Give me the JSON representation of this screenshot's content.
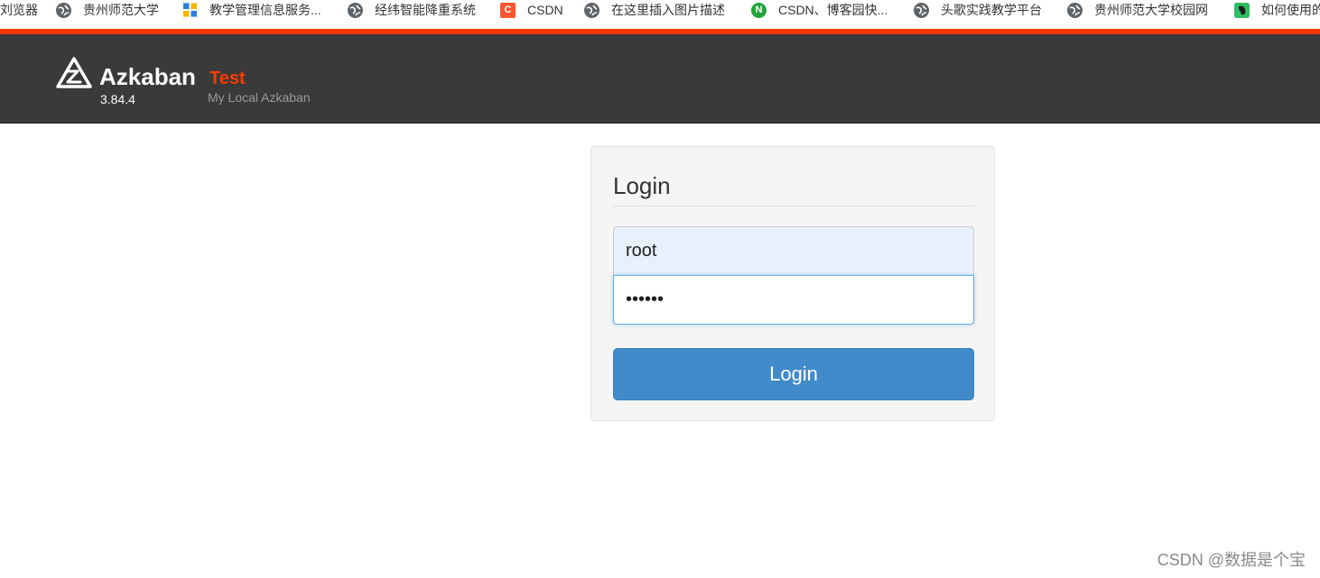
{
  "bookmarks": [
    {
      "label": "刘览器",
      "icon": "none"
    },
    {
      "label": "贵州师范大学",
      "icon": "globe-icon"
    },
    {
      "label": "教学管理信息服务...",
      "icon": "cube-icon"
    },
    {
      "label": "经纬智能降重系统",
      "icon": "globe-icon"
    },
    {
      "label": "CSDN",
      "icon": "csdn-icon"
    },
    {
      "label": "在这里插入图片描述",
      "icon": "globe-icon"
    },
    {
      "label": "CSDN、博客园快...",
      "icon": "n-icon"
    },
    {
      "label": "头歌实践教学平台",
      "icon": "globe-icon"
    },
    {
      "label": "贵州师范大学校园网",
      "icon": "globe-icon"
    },
    {
      "label": "如何使用的",
      "icon": "evernote-icon"
    }
  ],
  "header": {
    "brand": "Azkaban",
    "environment": "Test",
    "version": "3.84.4",
    "subtitle": "My Local Azkaban"
  },
  "login": {
    "title": "Login",
    "username_value": "root",
    "password_value": "••••••",
    "button_label": "Login"
  },
  "watermark": "CSDN @数据是个宝",
  "colors": {
    "accent": "#ff3a00",
    "header_bg": "#3a3a3a",
    "button_bg": "#428bca"
  }
}
